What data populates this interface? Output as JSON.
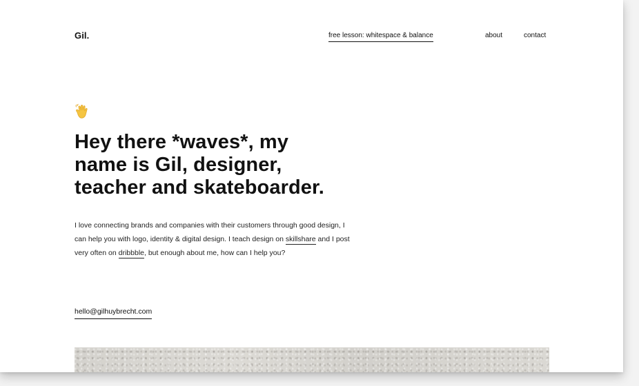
{
  "header": {
    "brand": "Gil.",
    "nav": {
      "lesson": "free lesson: whitespace & balance",
      "about": "about",
      "contact": "contact"
    }
  },
  "hero": {
    "icon": "waving-hand-icon",
    "headline_lines": [
      "Hey there *waves*, my",
      "name is Gil, designer,",
      "teacher and skateboarder."
    ],
    "intro": {
      "part1": "I love connecting brands and companies with their customers through good design, I can help you with logo, identity & digital design. I teach design on ",
      "link_skillshare": "skillshare",
      "part2": " and I post very often on ",
      "link_dribbble": "dribbble",
      "part3": ", but enough about me, how can I help you?"
    },
    "email": "hello@gilhuybrecht.com"
  },
  "colors": {
    "text": "#111111",
    "page_background": "#ffffff",
    "outer_background": "#f3f3f3",
    "wave_emoji": "#f5c542"
  }
}
